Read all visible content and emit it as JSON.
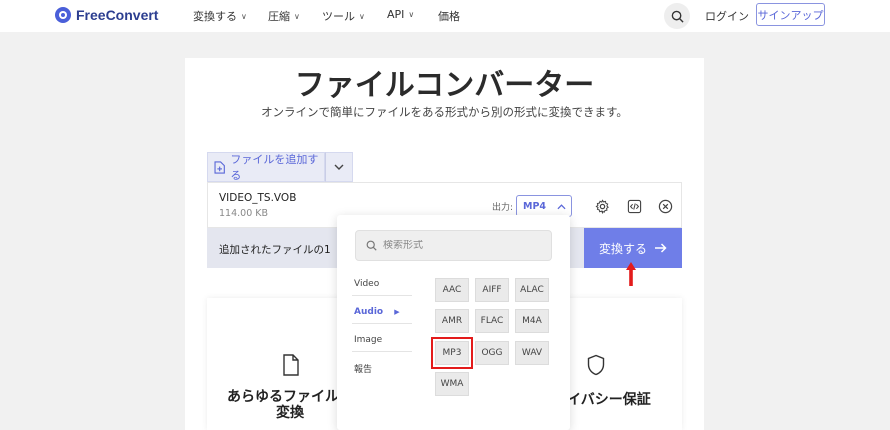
{
  "nav": {
    "logo": "FreeConvert",
    "items": [
      {
        "label": "変換する",
        "chevron": true
      },
      {
        "label": "圧縮",
        "chevron": true
      },
      {
        "label": "ツール",
        "chevron": true
      },
      {
        "label": "API",
        "chevron": true
      },
      {
        "label": "価格",
        "chevron": false
      }
    ],
    "login": "ログイン",
    "signup": "サインアップ"
  },
  "hero": {
    "title": "ファイルコンバーター",
    "subtitle": "オンラインで簡単にファイルをある形式から別の形式に変換できます。"
  },
  "add_files": {
    "label": "ファイルを追加する"
  },
  "file": {
    "name": "VIDEO_TS.VOB",
    "size": "114.00 KB",
    "output_label": "出力:",
    "output_value": "MP4"
  },
  "added_bar": {
    "text": "追加されたファイルの1"
  },
  "convert": {
    "label": "変換する"
  },
  "features": [
    {
      "title_line1": "あらゆるファイル",
      "title_line2": "変換"
    },
    {
      "title_line1": "イバシー保証"
    }
  ],
  "dropdown": {
    "search_placeholder": "検索形式",
    "categories": [
      "Video",
      "Audio",
      "Image",
      "報告"
    ],
    "active_category": "Audio",
    "formats": [
      "AAC",
      "AIFF",
      "ALAC",
      "AMR",
      "FLAC",
      "M4A",
      "MP3",
      "OGG",
      "WAV",
      "WMA"
    ],
    "highlighted_format": "MP3"
  },
  "colors": {
    "accent": "#6f7ee8",
    "brand": "#4a5fd9",
    "highlight": "#e31b1b"
  }
}
